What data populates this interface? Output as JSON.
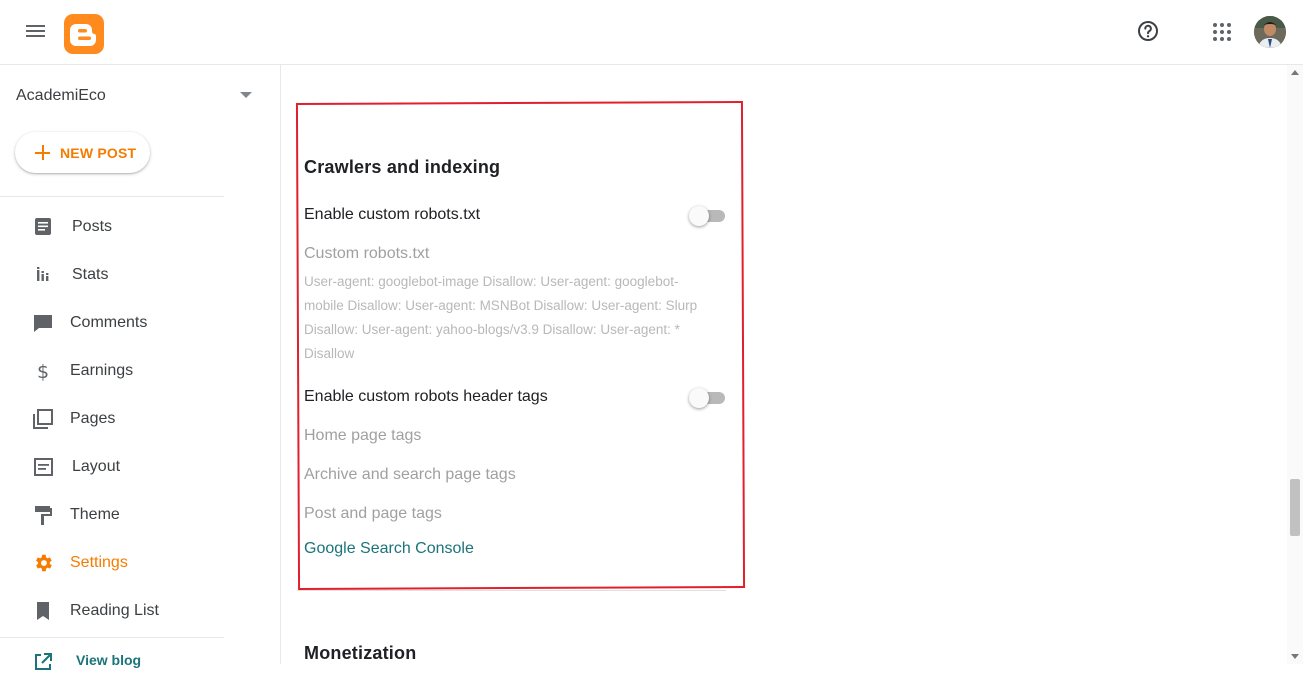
{
  "app": {
    "blog_name": "AcademiEco",
    "new_post_label": "NEW POST",
    "brand_color": "#ff8a1e",
    "accent_color": "#f57c00",
    "link_color": "#1a7479",
    "highlight_color": "#e0202b"
  },
  "header": {
    "menu_icon": "hamburger-menu-icon",
    "logo_icon": "blogger-logo-icon",
    "help_icon": "help-circle-icon",
    "apps_icon": "apps-grid-icon",
    "avatar": "user-avatar"
  },
  "sidebar": {
    "items": [
      {
        "label": "Posts",
        "icon": "posts-icon",
        "active": false
      },
      {
        "label": "Stats",
        "icon": "stats-icon",
        "active": false
      },
      {
        "label": "Comments",
        "icon": "comments-icon",
        "active": false
      },
      {
        "label": "Earnings",
        "icon": "dollar-icon",
        "active": false
      },
      {
        "label": "Pages",
        "icon": "pages-icon",
        "active": false
      },
      {
        "label": "Layout",
        "icon": "layout-icon",
        "active": false
      },
      {
        "label": "Theme",
        "icon": "paint-roller-icon",
        "active": false
      },
      {
        "label": "Settings",
        "icon": "gear-icon",
        "active": true
      },
      {
        "label": "Reading List",
        "icon": "bookmark-icon",
        "active": false
      }
    ],
    "view_blog_label": "View blog"
  },
  "main": {
    "crawlers": {
      "title": "Crawlers and indexing",
      "robots_toggle_label": "Enable custom robots.txt",
      "robots_toggle_on": false,
      "custom_robots_label": "Custom robots.txt",
      "custom_robots_value": "User-agent: googlebot-image Disallow: User-agent: googlebot-mobile Disallow: User-agent: MSNBot Disallow: User-agent: Slurp Disallow: User-agent: yahoo-blogs/v3.9 Disallow: User-agent: * Disallow",
      "header_tags_toggle_label": "Enable custom robots header tags",
      "header_tags_toggle_on": false,
      "home_tags_label": "Home page tags",
      "archive_tags_label": "Archive and search page tags",
      "post_tags_label": "Post and page tags",
      "search_console_label": "Google Search Console"
    },
    "monetization": {
      "title": "Monetization"
    }
  }
}
